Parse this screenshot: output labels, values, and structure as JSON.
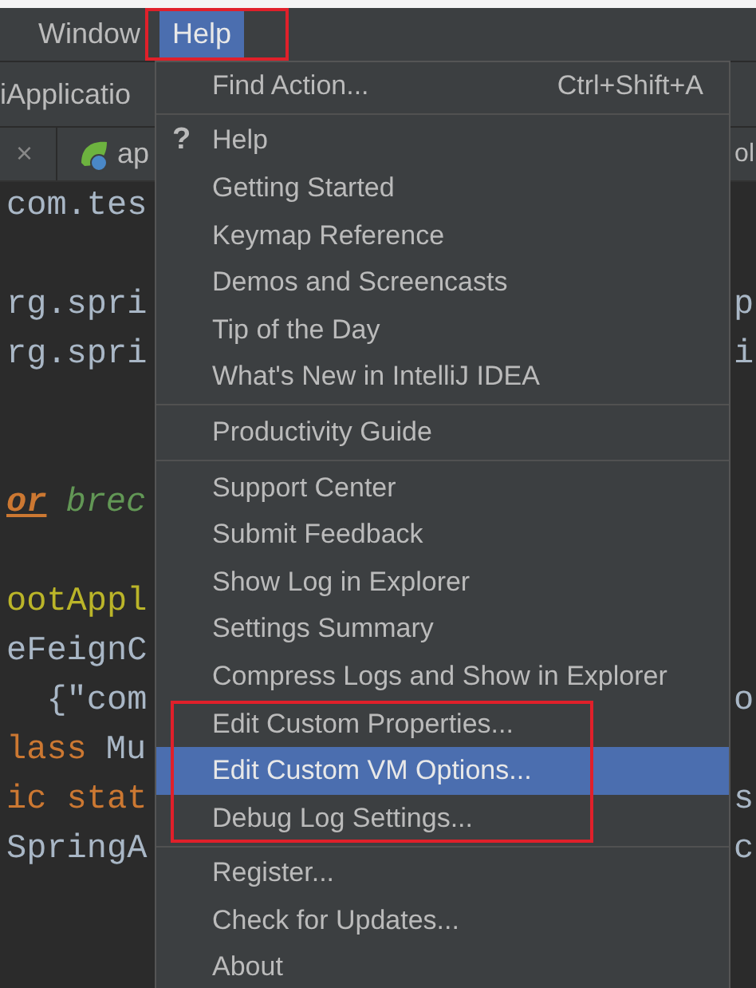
{
  "menubar": [
    {
      "label": "Window",
      "selected": false,
      "highlighted": false
    },
    {
      "label": "Help",
      "selected": true,
      "highlighted": true
    }
  ],
  "toolbar": {
    "label": "iApplicatio"
  },
  "editor_tabs": [
    {
      "kind": "close",
      "label": "×"
    },
    {
      "kind": "file",
      "label": "ap"
    },
    {
      "kind": "partial",
      "label": "ol"
    }
  ],
  "code_lines": [
    {
      "kind": "code",
      "left": [
        {
          "text": "com.tes",
          "kind": "plain"
        }
      ]
    },
    {
      "kind": "blank"
    },
    {
      "left": [
        {
          "text": "rg.spri",
          "kind": "plain"
        }
      ],
      "right": [
        {
          "text": "p",
          "kind": "plain"
        }
      ]
    },
    {
      "left": [
        {
          "text": "rg.spri",
          "kind": "plain"
        }
      ],
      "right": [
        {
          "text": "i",
          "kind": "plain"
        }
      ]
    },
    {
      "kind": "blank"
    },
    {
      "kind": "blank"
    },
    {
      "left": [
        {
          "text": "or",
          "kind": "tag"
        },
        {
          "text": "brec",
          "kind": "comment"
        }
      ]
    },
    {
      "kind": "blank"
    },
    {
      "left": [
        {
          "text": "ootAppl",
          "kind": "annotation"
        }
      ]
    },
    {
      "left": [
        {
          "text": "eFeignC",
          "kind": "plain"
        }
      ]
    },
    {
      "left": [
        {
          "text": "  {\"com",
          "kind": "plain"
        }
      ],
      "right": [
        {
          "text": "o",
          "kind": "plain"
        }
      ]
    },
    {
      "left": [
        {
          "text": "lass",
          "kind": "keyword"
        },
        {
          "text": "Mu",
          "kind": "plain"
        }
      ]
    },
    {
      "left": [
        {
          "text": "ic stat",
          "kind": "keyword"
        }
      ],
      "right": [
        {
          "text": "s",
          "kind": "plain"
        }
      ]
    },
    {
      "left": [
        {
          "text": "SpringA",
          "kind": "plain"
        }
      ],
      "right": [
        {
          "text": "c",
          "kind": "plain"
        }
      ]
    }
  ],
  "menu": {
    "items": [
      {
        "kind": "item",
        "label": "Find Action...",
        "shortcut": "Ctrl+Shift+A",
        "selected": false,
        "highlighted": false
      },
      {
        "kind": "separator"
      },
      {
        "kind": "item",
        "icon": "?",
        "label": "Help",
        "selected": false,
        "highlighted": false
      },
      {
        "kind": "item",
        "label": "Getting Started",
        "selected": false,
        "highlighted": false
      },
      {
        "kind": "item",
        "label": "Keymap Reference",
        "selected": false,
        "highlighted": false
      },
      {
        "kind": "item",
        "label": "Demos and Screencasts",
        "selected": false,
        "highlighted": false
      },
      {
        "kind": "item",
        "label": "Tip of the Day",
        "selected": false,
        "highlighted": false
      },
      {
        "kind": "item",
        "label": "What's New in IntelliJ IDEA",
        "selected": false,
        "highlighted": false
      },
      {
        "kind": "separator"
      },
      {
        "kind": "item",
        "label": "Productivity Guide",
        "selected": false,
        "highlighted": false
      },
      {
        "kind": "separator"
      },
      {
        "kind": "item",
        "label": "Support Center",
        "selected": false,
        "highlighted": false
      },
      {
        "kind": "item",
        "label": "Submit Feedback",
        "selected": false,
        "highlighted": false
      },
      {
        "kind": "item",
        "label": "Show Log in Explorer",
        "selected": false,
        "highlighted": false
      },
      {
        "kind": "item",
        "label": "Settings Summary",
        "selected": false,
        "highlighted": false
      },
      {
        "kind": "item",
        "label": "Compress Logs and Show in Explorer",
        "selected": false,
        "highlighted": false
      },
      {
        "kind": "item",
        "label": "Edit Custom Properties...",
        "selected": false,
        "highlighted": true
      },
      {
        "kind": "item",
        "label": "Edit Custom VM Options...",
        "selected": true,
        "highlighted": true
      },
      {
        "kind": "item",
        "label": "Debug Log Settings...",
        "selected": false,
        "highlighted": true
      },
      {
        "kind": "separator"
      },
      {
        "kind": "item",
        "label": "Register...",
        "selected": false,
        "highlighted": false
      },
      {
        "kind": "item",
        "label": "Check for Updates...",
        "selected": false,
        "highlighted": false
      },
      {
        "kind": "item",
        "label": "About",
        "selected": false,
        "highlighted": false
      }
    ]
  }
}
